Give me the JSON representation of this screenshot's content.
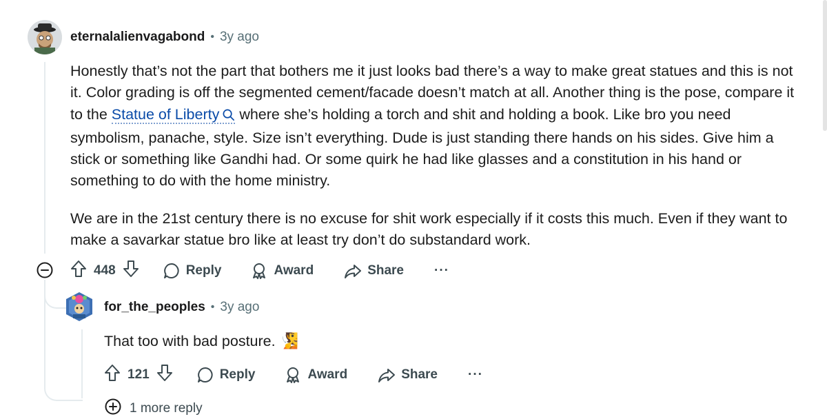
{
  "comment": {
    "username": "eternalalienvagabond",
    "age": "3y ago",
    "paragraph1_before_link": "Honestly that’s not the part that bothers me it just looks bad there’s a way to make great statues and this is not it. Color grading is off the segmented cement/facade doesn’t match at all. Another thing is the pose, compare it to the ",
    "link_text": "Statue of Liberty",
    "paragraph1_after_link": " where she’s holding a torch and shit and holding a book. Like bro you need symbolism, panache, style. Size isn’t everything. Dude is just standing there hands on his sides. Give him a stick or something like Gandhi had. Or some quirk he had like glasses and a constitution in his hand or something to do with the home ministry.",
    "paragraph2": "We are in the 21st century there is no excuse for shit work especially if it costs this much. Even if they want to make a savarkar statue bro like at least try don’t do substandard work.",
    "votes": "448",
    "reply_label": "Reply",
    "award_label": "Award",
    "share_label": "Share",
    "more_label": "···"
  },
  "reply": {
    "username": "for_the_peoples",
    "age": "3y ago",
    "text": "That too with bad posture. ",
    "emoji": "🧏",
    "votes": "121",
    "reply_label": "Reply",
    "award_label": "Award",
    "share_label": "Share",
    "more_label": "···"
  },
  "more_replies_label": "1 more reply",
  "icons": {
    "upvote": "arrow-up-icon",
    "downvote": "arrow-down-icon",
    "reply": "speech-bubble-icon",
    "award": "award-ribbon-icon",
    "share": "share-arrow-icon",
    "collapse": "minus-circle-icon",
    "expand": "plus-circle-icon",
    "search": "search-icon"
  },
  "colors": {
    "link": "#0a4ba8",
    "muted": "#576f76",
    "action": "#3c4a50",
    "thread_line": "#e5ebee"
  }
}
